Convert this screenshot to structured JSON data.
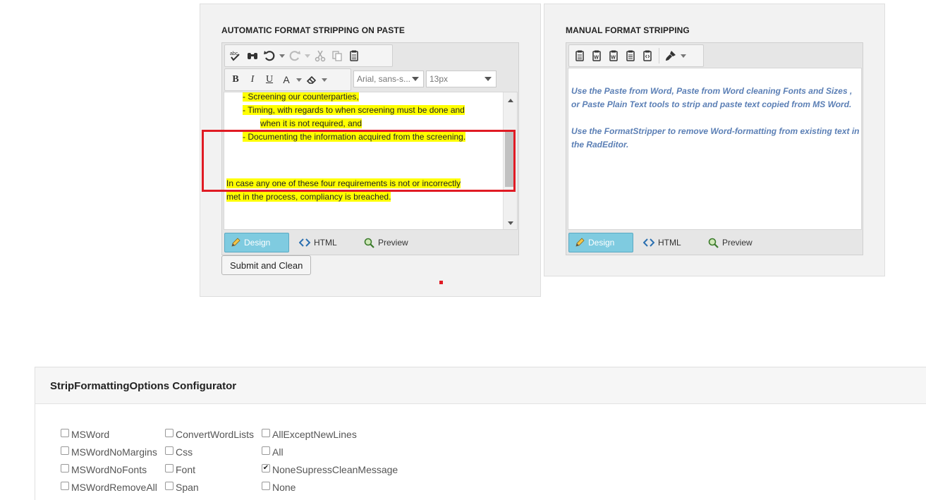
{
  "left_panel": {
    "title": "AUTOMATIC FORMAT STRIPPING ON PASTE",
    "font_select": "Arial, sans-s...",
    "size_select": "13px",
    "format_letters": [
      "B",
      "I",
      "U",
      "A"
    ],
    "content_lines": [
      "-    Screening our counterparties,",
      "-    Timing, with regards to when screening must be done and",
      "when it is not required, and",
      "-    Documenting the information acquired from the screening.",
      "In case any one of these four requirements is not or incorrectly",
      "met in the process, compliancy is breached."
    ],
    "modes": [
      "Design",
      "HTML",
      "Preview"
    ],
    "submit_label": "Submit and Clean"
  },
  "right_panel": {
    "title": "MANUAL FORMAT STRIPPING",
    "paragraph1": "Use the Paste from Word, Paste from Word cleaning Fonts and Sizes , or Paste Plain Text tools to strip and paste text copied from MS Word.",
    "paragraph2": "Use the FormatStripper to remove Word-formatting from existing text in the RadEditor.",
    "modes": [
      "Design",
      "HTML",
      "Preview"
    ]
  },
  "configurator": {
    "title": "StripFormattingOptions Configurator",
    "options": [
      {
        "label": "MSWord",
        "checked": false
      },
      {
        "label": "MSWordNoMargins",
        "checked": false
      },
      {
        "label": "MSWordNoFonts",
        "checked": false
      },
      {
        "label": "MSWordRemoveAll",
        "checked": false
      },
      {
        "label": "ConvertWordLists",
        "checked": false
      },
      {
        "label": "Css",
        "checked": false
      },
      {
        "label": "Font",
        "checked": false
      },
      {
        "label": "Span",
        "checked": false
      },
      {
        "label": "AllExceptNewLines",
        "checked": false
      },
      {
        "label": "All",
        "checked": false
      },
      {
        "label": "NoneSupressCleanMessage",
        "checked": true
      },
      {
        "label": "None",
        "checked": false
      }
    ]
  },
  "colors": {
    "highlight": "#ffff00",
    "annotation_red": "#e01b24",
    "manual_text": "#5b7fb5",
    "design_active": "#7fcbe0"
  }
}
